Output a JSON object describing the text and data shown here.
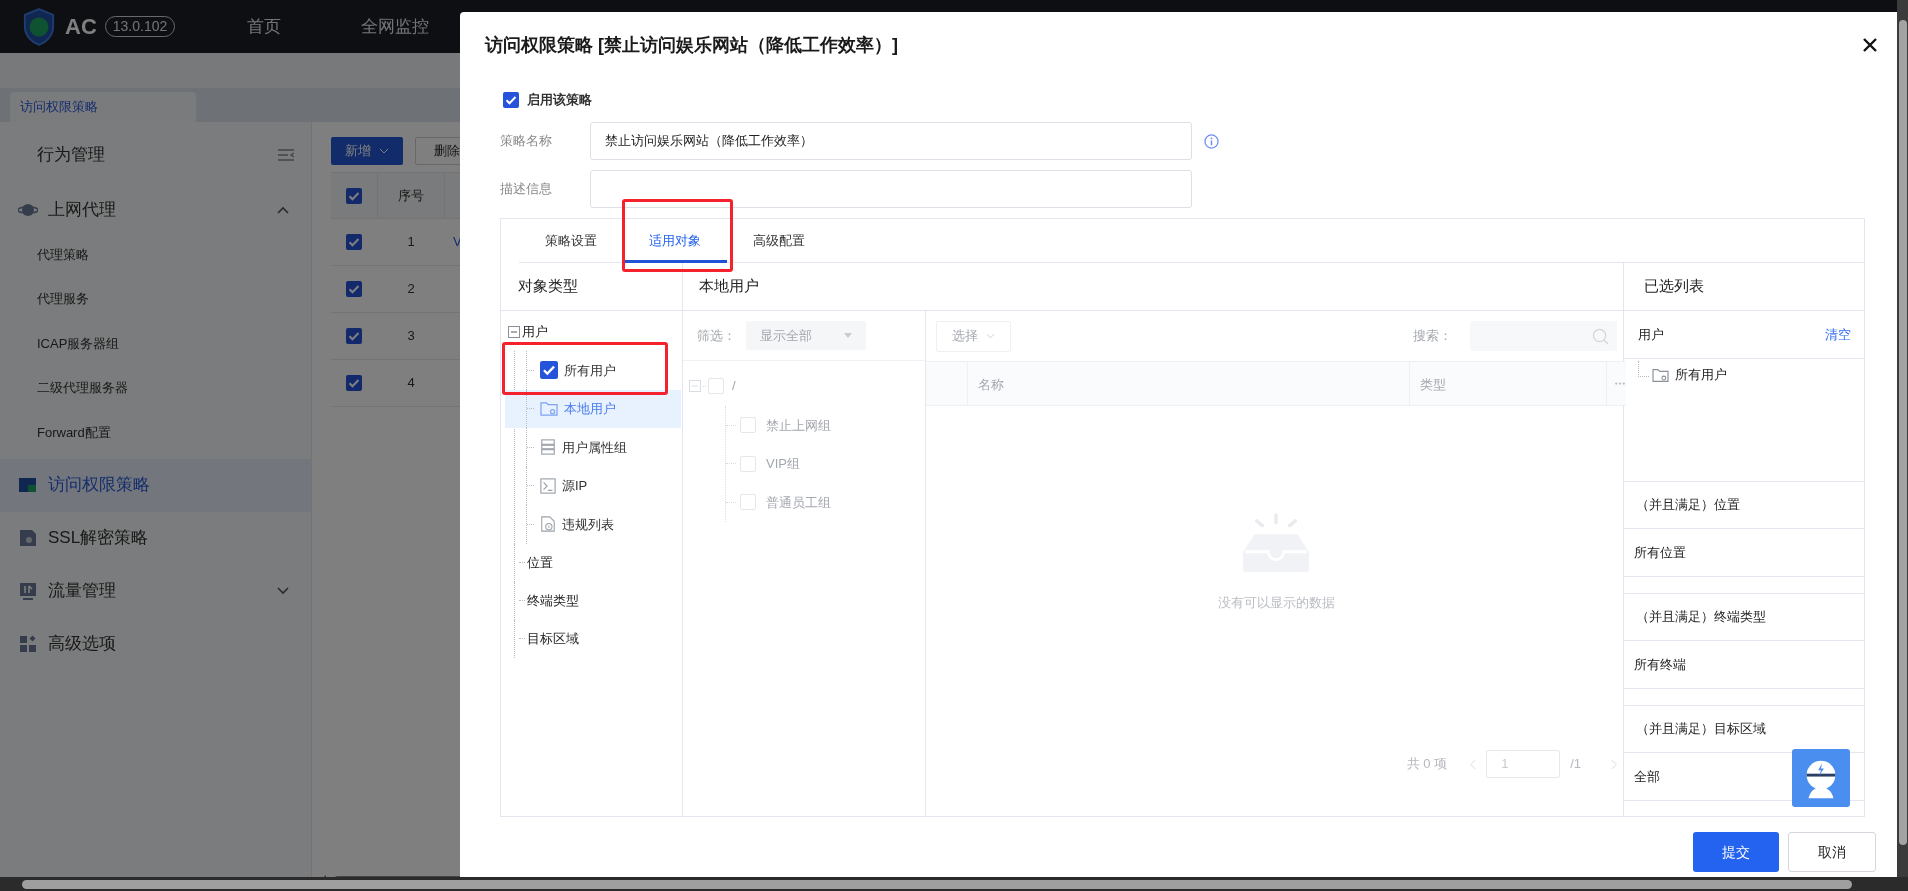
{
  "app": {
    "logo_text": "AC",
    "version": "13.0.102",
    "nav": [
      {
        "label": "首页"
      },
      {
        "label": "全网监控"
      }
    ]
  },
  "page_tab": {
    "label": "访问权限策略"
  },
  "sidebar": {
    "items": [
      {
        "label": "行为管理",
        "kind": "title"
      },
      {
        "label": "上网代理",
        "kind": "group",
        "selected": false,
        "expanded": true,
        "children": [
          {
            "label": "代理策略",
            "selected": false
          },
          {
            "label": "代理服务",
            "selected": false
          },
          {
            "label": "ICAP服务器组",
            "selected": false
          },
          {
            "label": "二级代理服务器",
            "selected": false
          },
          {
            "label": "Forward配置",
            "selected": false
          }
        ]
      },
      {
        "label": "访问权限策略",
        "kind": "item",
        "selected": true
      },
      {
        "label": "SSL解密策略",
        "kind": "item",
        "selected": false
      },
      {
        "label": "流量管理",
        "kind": "group",
        "selected": false,
        "expanded": false
      },
      {
        "label": "高级选项",
        "kind": "item",
        "selected": false
      }
    ]
  },
  "toolbar": {
    "buttons": [
      {
        "label": "新增",
        "kind": "primary"
      },
      {
        "label": "删除",
        "kind": "default"
      }
    ]
  },
  "table": {
    "all_checked": true,
    "columns": [
      "序号"
    ],
    "rows": [
      {
        "checked": true,
        "number": "1",
        "column_3": "V"
      },
      {
        "checked": true,
        "number": "2"
      },
      {
        "checked": true,
        "number": "3"
      },
      {
        "checked": true,
        "number": "4"
      }
    ]
  },
  "dialog": {
    "title": "访问权限策略 [禁止访问娱乐网站（降低工作效率）]",
    "enable": {
      "label": "启用该策略",
      "checked": true
    },
    "fields": [
      {
        "label": "策略名称",
        "value": "禁止访问娱乐网站（降低工作效率）",
        "info": true
      },
      {
        "label": "描述信息",
        "info": false
      }
    ],
    "tabs": [
      {
        "label": "策略设置",
        "selected": false
      },
      {
        "label": "适用对象",
        "selected": true
      },
      {
        "label": "高级配置",
        "selected": false
      }
    ],
    "object_types": {
      "title": "对象类型",
      "tree": [
        {
          "label": "用户",
          "expanded": true,
          "selected": false,
          "children": [
            {
              "label": "所有用户",
              "kind": "checkbox",
              "checked": true,
              "selected": false
            },
            {
              "label": "本地用户",
              "kind": "folder",
              "selected": true
            },
            {
              "label": "用户属性组",
              "kind": "group",
              "selected": false
            },
            {
              "label": "源IP",
              "kind": "terminal",
              "selected": false
            },
            {
              "label": "违规列表",
              "kind": "list",
              "selected": false
            }
          ]
        },
        {
          "label": "位置",
          "selected": false
        },
        {
          "label": "终端类型",
          "selected": false
        },
        {
          "label": "目标区域",
          "selected": false
        }
      ]
    },
    "local_users": {
      "title": "本地用户",
      "disabled": true,
      "filter": {
        "label": "筛选：",
        "value": "显示全部"
      },
      "tree": {
        "label": "/",
        "checked": false,
        "expanded": true,
        "children": [
          {
            "label": "禁止上网组",
            "checked": false
          },
          {
            "label": "VIP组",
            "checked": false
          },
          {
            "label": "普通员工组",
            "checked": false
          }
        ]
      },
      "select": {
        "label": "选择"
      },
      "search": {
        "label": "搜索："
      },
      "columns": [
        "名称",
        "类型"
      ],
      "empty_text": "没有可以显示的数据",
      "pagination": {
        "total": "共 0 项",
        "page": "1",
        "pages": "/1"
      }
    },
    "selected_list": {
      "title": "已选列表",
      "sections": [
        {
          "kind": "tree",
          "heading": "用户",
          "action": "清空",
          "items": [
            {
              "label": "所有用户"
            }
          ]
        },
        {
          "kind": "plain",
          "heading": "（并且满足）位置",
          "items": [
            {
              "label": "所有位置"
            }
          ]
        },
        {
          "kind": "plain",
          "heading": "（并且满足）终端类型",
          "items": [
            {
              "label": "所有终端"
            }
          ]
        },
        {
          "kind": "plain",
          "heading": "（并且满足）目标区域",
          "items": [
            {
              "label": "全部"
            }
          ]
        }
      ]
    },
    "buttons": [
      {
        "label": "提交",
        "kind": "primary"
      },
      {
        "label": "取消",
        "kind": "default"
      }
    ]
  }
}
